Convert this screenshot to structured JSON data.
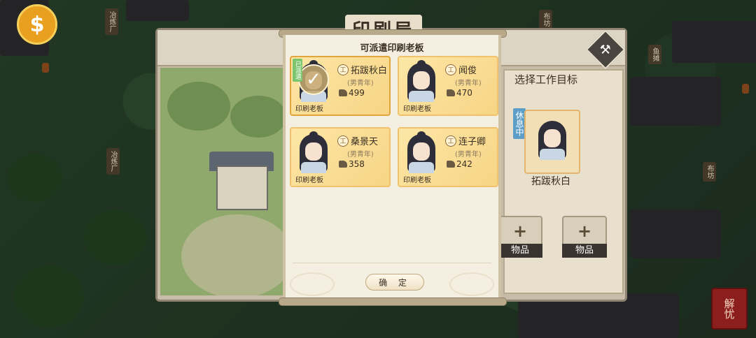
{
  "background": {
    "coin_button_label": "$",
    "map_tags": [
      "冶炼厂",
      "布坊",
      "鱼摊",
      "布坊",
      "冶炼厂"
    ],
    "seal_label": "解忧"
  },
  "building_panel": {
    "title": "印刷局",
    "select_goal_label": "选择工作目标",
    "current_worker": {
      "status": "休息中",
      "name": "拓跋秋白"
    },
    "item_slots": [
      {
        "plus": "+",
        "label": "物品"
      },
      {
        "plus": "+",
        "label": "物品"
      }
    ]
  },
  "dispatch_dialog": {
    "title": "可派遣印刷老板",
    "confirm_label": "确 定",
    "dispatched_tag": "已派遣",
    "cards": [
      {
        "name": "拓跋秋白",
        "craft_icon": "工",
        "gender": "(男青年)",
        "skill": "499",
        "role": "印刷老板",
        "dispatched": true
      },
      {
        "name": "闻俊",
        "craft_icon": "工",
        "gender": "(男青年)",
        "skill": "470",
        "role": "印刷老板",
        "dispatched": false
      },
      {
        "name": "桑景天",
        "craft_icon": "工",
        "gender": "(男青年)",
        "skill": "358",
        "role": "印刷老板",
        "dispatched": false
      },
      {
        "name": "连子卿",
        "craft_icon": "工",
        "gender": "(男青年)",
        "skill": "242",
        "role": "印刷老板",
        "dispatched": false
      }
    ]
  },
  "colors": {
    "card_bg": "#f7d585",
    "card_border": "#f0c26d",
    "scroll_bg": "#f5efe1",
    "rest_badge": "#5d9ec8",
    "dispatched_tag": "#7cc56e"
  }
}
